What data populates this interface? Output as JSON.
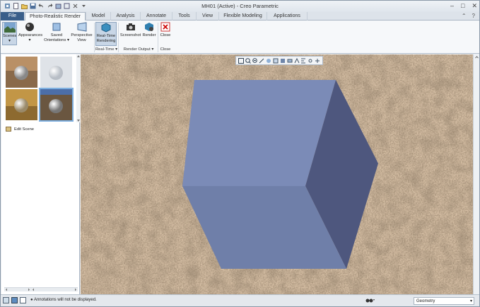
{
  "window": {
    "title": "MH01 (Active) - Creo Parametric"
  },
  "tabs": [
    {
      "label": "File"
    },
    {
      "label": "Photo-Realistic Render"
    },
    {
      "label": "Model"
    },
    {
      "label": "Analysis"
    },
    {
      "label": "Annotate"
    },
    {
      "label": "Tools"
    },
    {
      "label": "View"
    },
    {
      "label": "Flexible Modeling"
    },
    {
      "label": "Applications"
    }
  ],
  "ribbon": {
    "scenes": "Scenes",
    "appearances": "Appearances",
    "saved_orientations_1": "Saved",
    "saved_orientations_2": "Orientations",
    "perspective_view_1": "Perspective",
    "perspective_view_2": "View",
    "realtime_1": "Real-Time",
    "realtime_2": "Rendering",
    "screenshot": "Screenshot",
    "render": "Render",
    "close": "Close",
    "group_realtime": "Real-Time",
    "group_render_output": "Render Output",
    "group_close": "Close"
  },
  "left_panel": {
    "edit_scene": "Edit Scene"
  },
  "status": {
    "message": "Annotations will not be displayed.",
    "filter_value": "Geometry"
  },
  "colors": {
    "accent": "#3a5f8a",
    "cube_top": "#7b8bb7",
    "cube_front": "#6f7fa9",
    "cube_side": "#4e577e"
  }
}
